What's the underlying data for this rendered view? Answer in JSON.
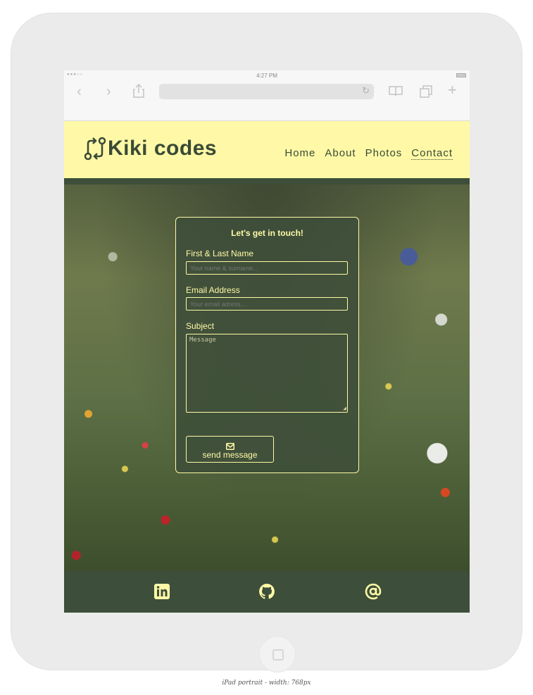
{
  "status_bar": {
    "time": "4:27 PM"
  },
  "site": {
    "logo_text": "Kiki codes",
    "nav": [
      "Home",
      "About",
      "Photos",
      "Contact"
    ],
    "active_nav": "Contact"
  },
  "contact_form": {
    "title": "Let's get in touch!",
    "name_label": "First & Last Name",
    "name_placeholder": "Your name & surname...",
    "email_label": "Email Address",
    "email_placeholder": "Your email adress...",
    "subject_label": "Subject",
    "message_placeholder": "Message",
    "send_label": "send message",
    "send_icon": "envelope-icon"
  },
  "footer": {
    "icons": [
      "linkedin-icon",
      "github-icon",
      "at-sign-icon"
    ]
  },
  "caption": "iPad portrait - width: 768px",
  "colors": {
    "brand_yellow": "#fff9a7",
    "brand_green": "#3d4e3a"
  }
}
